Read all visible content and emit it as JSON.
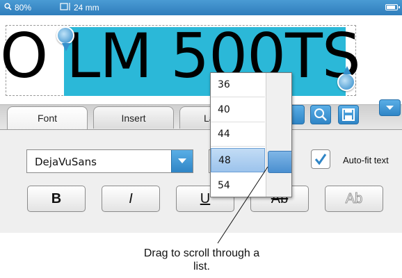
{
  "status_bar": {
    "zoom": "80%",
    "label_width": "24 mm",
    "icons": [
      "magnifier-icon",
      "label-width-icon",
      "battery-icon"
    ]
  },
  "label": {
    "text": "O LM 500TS"
  },
  "tabs": [
    {
      "label": "Font"
    },
    {
      "label": "Insert"
    },
    {
      "label": "La"
    }
  ],
  "toolbar": {
    "icons": [
      "text-a-icon",
      "zoom-icon",
      "save-icon",
      "chevron-down-icon"
    ]
  },
  "font": {
    "family": "DejaVuSans",
    "size_options": [
      "36",
      "40",
      "44",
      "48",
      "54"
    ],
    "selected_size": "48",
    "autofit_label": "Auto-fit text",
    "autofit_checked": true
  },
  "format_buttons": {
    "bold": "B",
    "italic": "I",
    "underline": "U",
    "strikethrough": "Ab",
    "outline": "Ab"
  },
  "callout": {
    "text": "Drag to scroll through a list."
  },
  "colors": {
    "accent": "#2f85c6",
    "selection": "#2bb8d8"
  }
}
